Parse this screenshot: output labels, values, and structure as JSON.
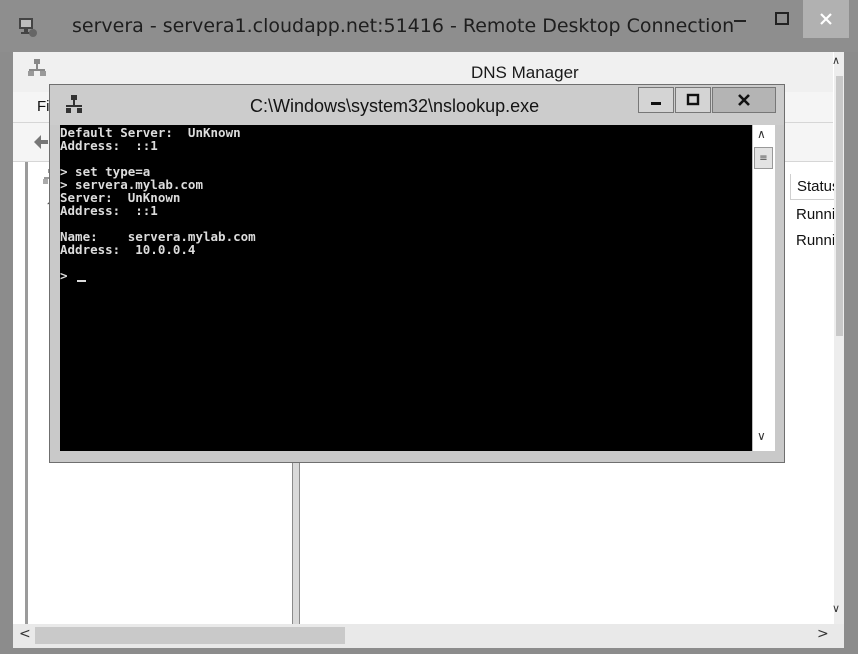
{
  "rdp": {
    "title": "servera - servera1.cloudapp.net:51416 - Remote Desktop Connection",
    "icon": "remote-desktop-icon",
    "minimize_icon": "minimize-icon",
    "maximize_icon": "maximize-icon",
    "close_icon": "close-icon"
  },
  "dns_manager": {
    "title": "DNS Manager",
    "icon": "dns-manager-icon",
    "menu_file": "Fi",
    "toolbar_back_icon": "back-arrow-icon",
    "column_header": "Status",
    "rows": [
      "Runni",
      "Runni"
    ]
  },
  "console": {
    "title": "C:\\Windows\\system32\\nslookup.exe",
    "icon": "console-app-icon",
    "lines": [
      "Default Server:  UnKnown",
      "Address:  ::1",
      "",
      "> set type=a",
      "> servera.mylab.com",
      "Server:  UnKnown",
      "Address:  ::1",
      "",
      "Name:    servera.mylab.com",
      "Address:  10.0.0.4",
      ""
    ],
    "prompt": "> "
  },
  "colors": {
    "rdp_chrome": "#8c8c8c",
    "console_bg": "#000000",
    "console_text": "#dcdcdc"
  }
}
